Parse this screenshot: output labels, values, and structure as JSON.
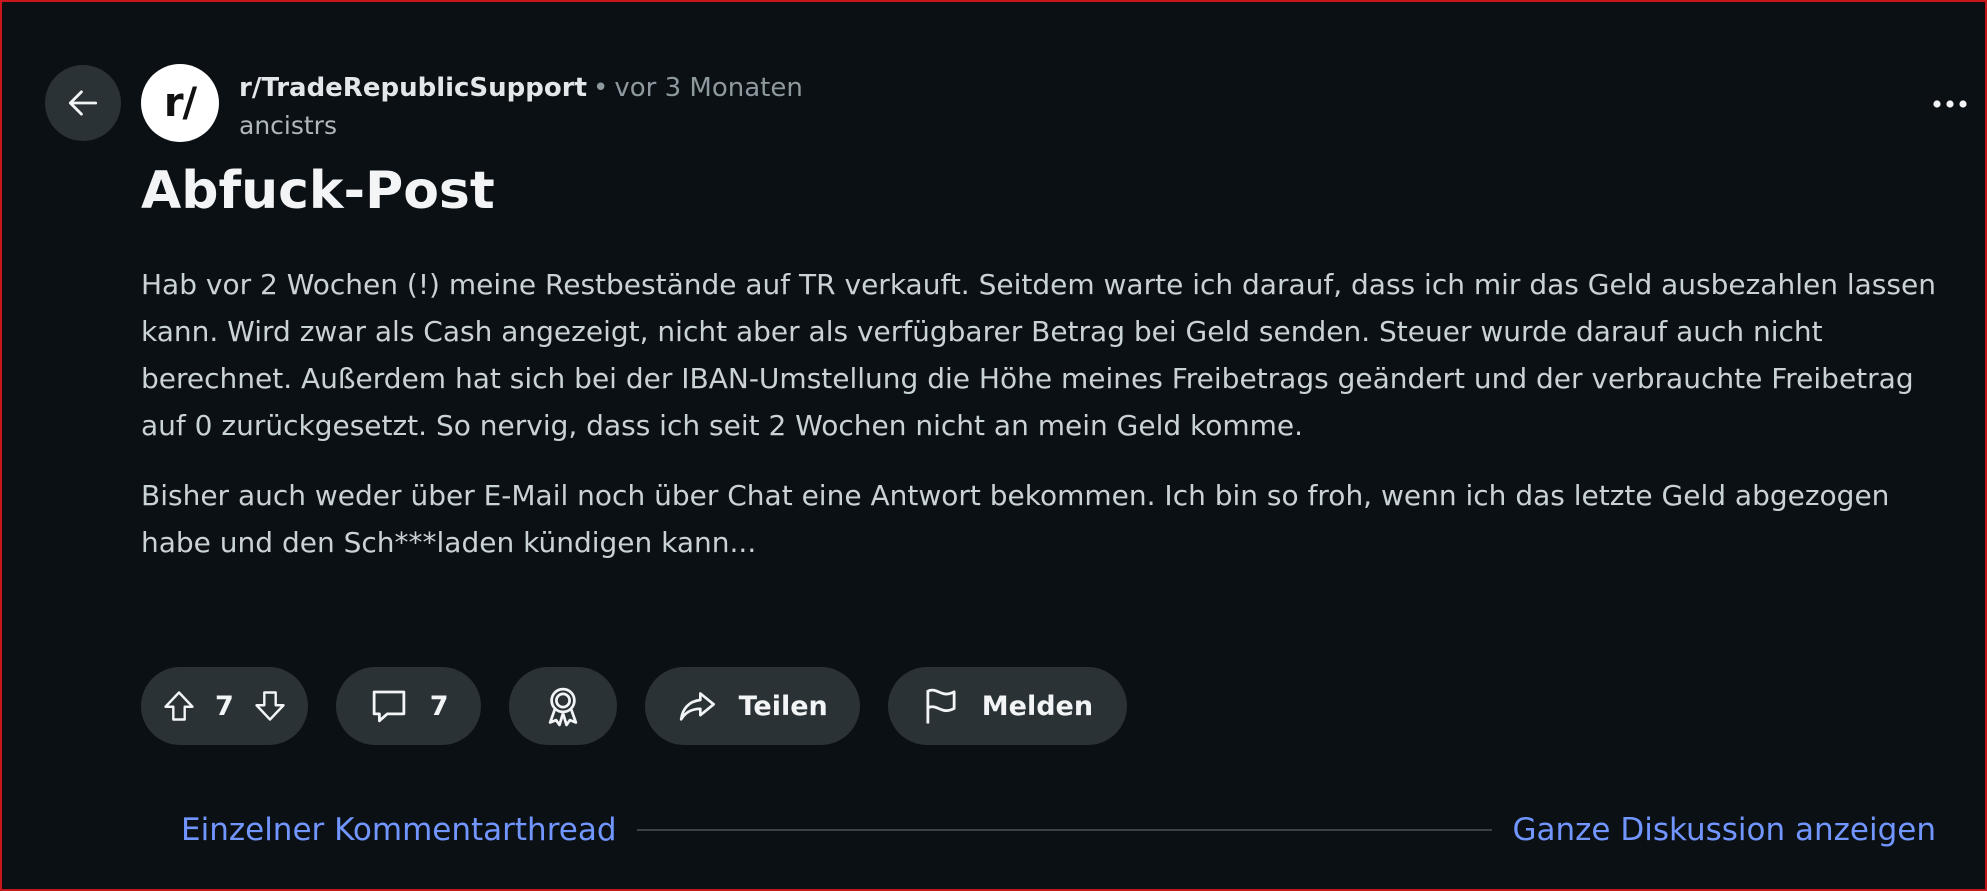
{
  "post": {
    "subreddit": "r/TradeRepublicSupport",
    "separator": "•",
    "time_ago": "vor 3 Monaten",
    "author": "ancistrs",
    "avatar_text": "r/",
    "title": "Abfuck-Post",
    "paragraphs": [
      "Hab vor 2 Wochen (!) meine Restbestände auf TR verkauft. Seitdem warte ich darauf, dass ich mir das Geld ausbezahlen lassen kann. Wird zwar als Cash angezeigt, nicht aber als verfügbarer Betrag bei Geld senden. Steuer wurde darauf auch nicht berechnet. Außerdem hat sich bei der IBAN-Umstellung die Höhe meines Freibetrags geändert und der verbrauchte Freibetrag auf 0 zurückgesetzt. So nervig, dass ich seit 2 Wochen nicht an mein Geld komme.",
      "Bisher auch weder über E-Mail noch über Chat eine Antwort bekommen. Ich bin so froh, wenn ich das letzte Geld abgezogen habe und den Sch***laden kündigen kann..."
    ]
  },
  "actions": {
    "vote_count": "7",
    "comment_count": "7",
    "share_label": "Teilen",
    "report_label": "Melden"
  },
  "thread": {
    "single_thread_label": "Einzelner Kommentarthread",
    "full_discussion_label": "Ganze Diskussion anzeigen"
  },
  "icons": {
    "back": "arrow-left-icon",
    "more": "more-horizontal-icon",
    "upvote": "upvote-arrow-icon",
    "downvote": "downvote-arrow-icon",
    "comment": "comment-bubble-icon",
    "award": "award-ribbon-icon",
    "share": "share-arrow-icon",
    "report": "flag-icon"
  },
  "colors": {
    "background": "#0b1015",
    "pill": "#2a3236",
    "link": "#7296ff",
    "frame_border": "#c8161d"
  }
}
